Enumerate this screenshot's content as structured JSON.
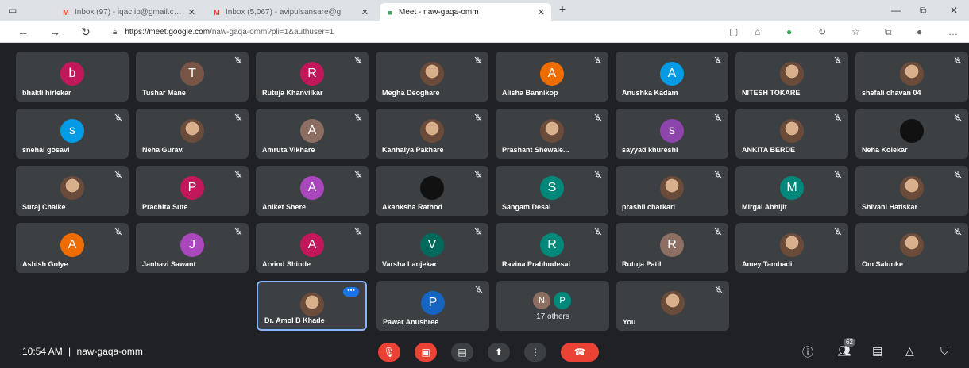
{
  "browser": {
    "tabs": [
      {
        "label": "Inbox (97) - iqac.ip@gmail.com",
        "icon": "gmail-icon"
      },
      {
        "label": "Inbox (5,067) - avipulsansare@g",
        "icon": "gmail-icon"
      },
      {
        "label": "Meet - naw-gaqa-omm",
        "icon": "meet-icon"
      }
    ],
    "new_tab": "+",
    "url_host": "https://meet.google.com",
    "url_path": "/naw-gaqa-omm?pli=1&authuser=1"
  },
  "participants": [
    {
      "name": "bhakti hirlekar",
      "initial": "b",
      "color": "#c2185b"
    },
    {
      "name": "Tushar Mane",
      "initial": "T",
      "color": "#795548"
    },
    {
      "name": "Rutuja Khanvilkar",
      "initial": "R",
      "color": "#c2185b"
    },
    {
      "name": "Megha Deoghare",
      "initial": "",
      "color": "photo"
    },
    {
      "name": "Alisha Bannikop",
      "initial": "A",
      "color": "#ef6c00"
    },
    {
      "name": "Anushka Kadam",
      "initial": "A",
      "color": "#039be5"
    },
    {
      "name": "NITESH TOKARE",
      "initial": "",
      "color": "photo"
    },
    {
      "name": "shefali chavan 04",
      "initial": "",
      "color": "photo"
    },
    {
      "name": "snehal gosavi",
      "initial": "s",
      "color": "#039be5"
    },
    {
      "name": "Neha Gurav.",
      "initial": "",
      "color": "photo"
    },
    {
      "name": "Amruta Vikhare",
      "initial": "A",
      "color": "#8d6e63"
    },
    {
      "name": "Kanhaiya Pakhare",
      "initial": "",
      "color": "photo"
    },
    {
      "name": "Prashant Shewale...",
      "initial": "",
      "color": "photo"
    },
    {
      "name": "sayyad khureshi",
      "initial": "s",
      "color": "#8e44ad"
    },
    {
      "name": "ANKITA BERDE",
      "initial": "",
      "color": "photo"
    },
    {
      "name": "Neha Kolekar",
      "initial": "",
      "color": "dark"
    },
    {
      "name": "Suraj Chalke",
      "initial": "",
      "color": "photo"
    },
    {
      "name": "Prachita Sute",
      "initial": "P",
      "color": "#c2185b"
    },
    {
      "name": "Aniket Shere",
      "initial": "A",
      "color": "#ab47bc"
    },
    {
      "name": "Akanksha Rathod",
      "initial": "",
      "color": "dark"
    },
    {
      "name": "Sangam Desai",
      "initial": "S",
      "color": "#00897b"
    },
    {
      "name": "prashil charkari",
      "initial": "",
      "color": "photo"
    },
    {
      "name": "Mirgal Abhijit",
      "initial": "M",
      "color": "#00897b"
    },
    {
      "name": "Shivani Hatiskar",
      "initial": "",
      "color": "photo"
    },
    {
      "name": "Ashish Golye",
      "initial": "A",
      "color": "#ef6c00"
    },
    {
      "name": "Janhavi Sawant",
      "initial": "J",
      "color": "#ab47bc"
    },
    {
      "name": "Arvind Shinde",
      "initial": "A",
      "color": "#c2185b"
    },
    {
      "name": "Varsha Lanjekar",
      "initial": "V",
      "color": "#00695c"
    },
    {
      "name": "Ravina Prabhudesai",
      "initial": "R",
      "color": "#00897b"
    },
    {
      "name": "Rutuja Patil",
      "initial": "R",
      "color": "#8d6e63"
    },
    {
      "name": "Amey Tambadi",
      "initial": "",
      "color": "photo"
    },
    {
      "name": "Om Salunke",
      "initial": "",
      "color": "photo"
    }
  ],
  "last_row": {
    "host": {
      "name": "Dr. Amol B Khade",
      "menu": "•••"
    },
    "pawar": {
      "name": "Pawar Anushree",
      "initial": "P",
      "color": "#1565c0"
    },
    "others": {
      "label": "17 others",
      "initials": [
        "N",
        "P"
      ],
      "colors": [
        "#8d6e63",
        "#00897b"
      ]
    },
    "you": {
      "name": "You"
    }
  },
  "bottombar": {
    "time": "10:54 AM",
    "separator": "|",
    "meeting_code": "naw-gaqa-omm",
    "people_count": "62"
  }
}
